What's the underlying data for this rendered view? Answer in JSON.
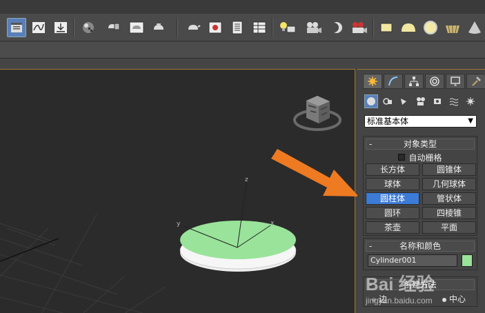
{
  "create_panel": {
    "category": "标准基本体",
    "object_type": {
      "title": "对象类型",
      "autogrid_label": "自动栅格",
      "primitives": [
        {
          "label": "长方体",
          "active": false
        },
        {
          "label": "圆锥体",
          "active": false
        },
        {
          "label": "球体",
          "active": false
        },
        {
          "label": "几何球体",
          "active": false
        },
        {
          "label": "圆柱体",
          "active": true
        },
        {
          "label": "管状体",
          "active": false
        },
        {
          "label": "圆环",
          "active": false
        },
        {
          "label": "四棱锥",
          "active": false
        },
        {
          "label": "茶壶",
          "active": false
        },
        {
          "label": "平面",
          "active": false
        }
      ]
    },
    "name_color": {
      "title": "名称和颜色",
      "object_name": "Cylinder001",
      "color": "#99e39a"
    },
    "creation_method": {
      "title": "创建方法",
      "options": [
        "边",
        "中心"
      ],
      "selected": "中心"
    }
  },
  "viewport": {
    "axis_labels": {
      "x": "x",
      "y": "y",
      "z": "z"
    },
    "cylinder_color": "#99e39a",
    "background": "#2b2b2b"
  },
  "watermark": {
    "brand": "Bai 经验",
    "url": "jingyan.baidu.com"
  },
  "colors": {
    "accent_blue": "#3c7bd6",
    "arrow_orange": "#ee7a22",
    "viewport_border": "#a07a3a"
  }
}
